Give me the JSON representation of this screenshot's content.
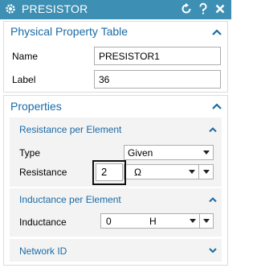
{
  "title": "PRESISTOR",
  "icons": {
    "settings": "gear-icon",
    "reset": "reset-icon",
    "help": "help-icon",
    "close": "close-icon"
  },
  "physical_property_table": {
    "title": "Physical Property Table",
    "name_label": "Name",
    "name_value": "PRESISTOR1",
    "label_label": "Label",
    "label_value": "36"
  },
  "properties": {
    "title": "Properties",
    "resistance_per_element": {
      "title": "Resistance per Element",
      "type_label": "Type",
      "type_value": "Given",
      "resistance_label": "Resistance",
      "resistance_value": "2",
      "resistance_unit": "Ω"
    },
    "inductance_per_element": {
      "title": "Inductance per Element",
      "inductance_label": "Inductance",
      "inductance_value": "0",
      "inductance_unit": "H"
    },
    "network_id": {
      "title": "Network ID"
    }
  },
  "colors": {
    "titlebar": "#3d8fb3",
    "section_title": "#1a6aa5"
  }
}
